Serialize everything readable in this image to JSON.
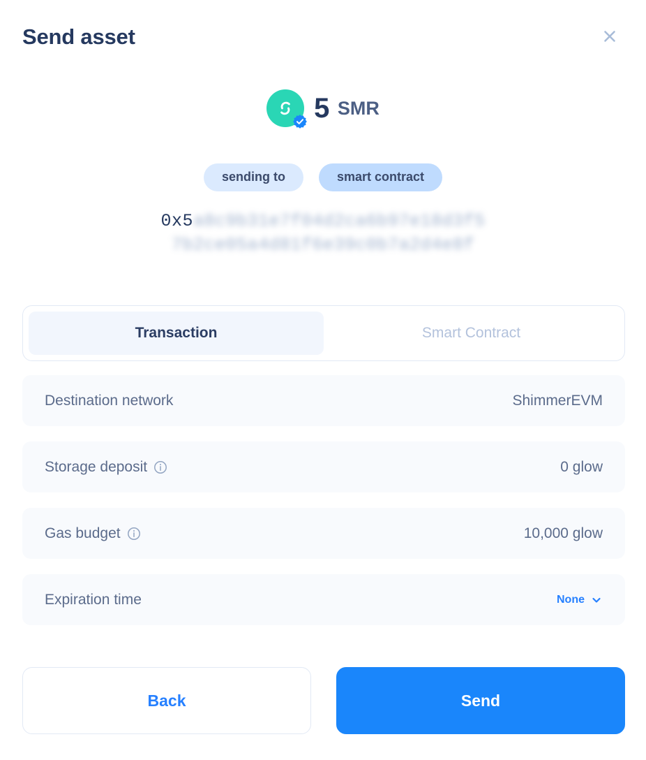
{
  "header": {
    "title": "Send asset",
    "close_icon": "close-icon"
  },
  "amount": {
    "token_icon": "shimmer-token-icon",
    "verified_icon": "verified-badge-icon",
    "value": "5",
    "unit": "SMR"
  },
  "recipient": {
    "pills": [
      {
        "label": "sending to",
        "style": "light"
      },
      {
        "label": "smart contract",
        "style": "strong"
      }
    ],
    "address_visible": "0x5",
    "address_redacted_line1": "a8c9b31e7f04d2ca6b97e18d3f5",
    "address_redacted_line2": "7b2ce05a4d81f6e39c0b7a2d4e8f"
  },
  "tabs": [
    {
      "label": "Transaction",
      "active": true
    },
    {
      "label": "Smart Contract",
      "active": false
    }
  ],
  "details": [
    {
      "label": "Destination network",
      "value": "ShimmerEVM",
      "info": false,
      "link": false
    },
    {
      "label": "Storage deposit",
      "value": "0 glow",
      "info": true,
      "link": false
    },
    {
      "label": "Gas budget",
      "value": "10,000 glow",
      "info": true,
      "link": false
    },
    {
      "label": "Expiration time",
      "value": "None",
      "info": false,
      "link": true
    }
  ],
  "footer": {
    "back_label": "Back",
    "send_label": "Send"
  },
  "colors": {
    "primary": "#1a86fb",
    "link": "#2680ff",
    "token": "#2ad6b5",
    "title": "#25395f",
    "row_bg": "#f8fafd",
    "pill_light": "#dbeafe",
    "pill_strong": "#bfdbfe"
  }
}
